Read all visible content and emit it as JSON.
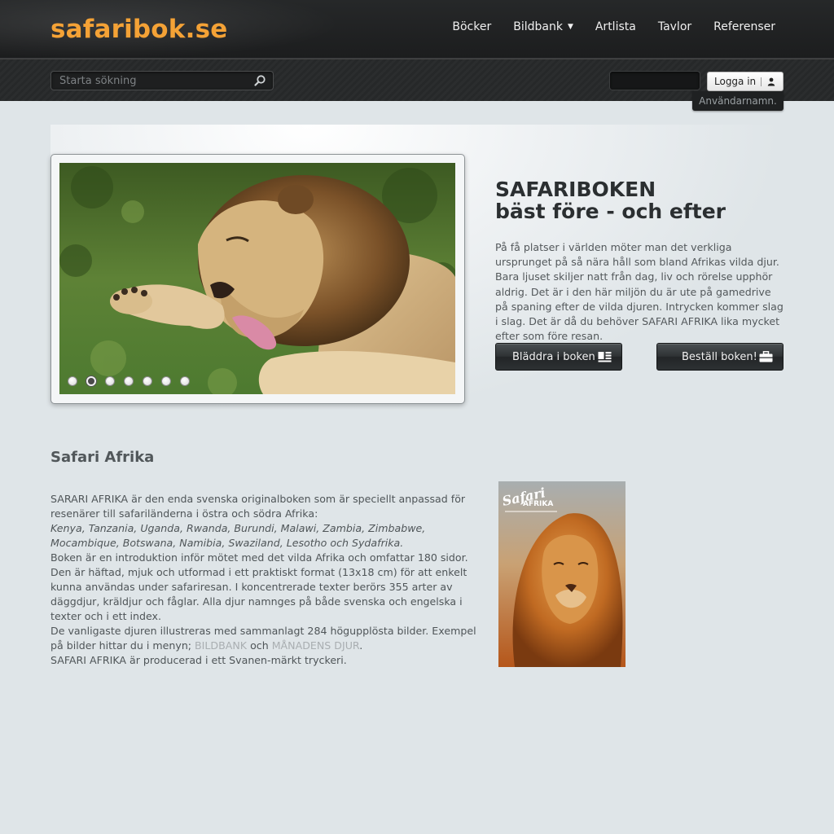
{
  "header": {
    "logo": "safaribok.se",
    "nav": [
      {
        "label": "Böcker"
      },
      {
        "label": "Bildbank",
        "dropdown": true,
        "caret": "▼"
      },
      {
        "label": "Artlista"
      },
      {
        "label": "Tavlor"
      },
      {
        "label": "Referenser"
      }
    ]
  },
  "subbar": {
    "search_placeholder": "Starta sökning",
    "login_label": "Logga in",
    "tooltip": "Användarnamn."
  },
  "hero": {
    "slider": {
      "dot_count": 7,
      "active_dot": 2
    },
    "title_line1": "SAFARIBOKEN",
    "title_line2": "bäst före - och efter",
    "text": "På få platser i världen möter man det verkliga ursprunget på så nära håll som bland Afrikas vilda djur. Bara ljuset skiljer natt från dag, liv och rörelse upphör aldrig. Det är i den här miljön du är ute på gamedrive på spaning efter de vilda djuren. Intrycken kommer slag i slag. Det är då du behöver SAFARI AFRIKA lika mycket efter som före resan.",
    "browse_button": "Bläddra i boken",
    "order_button": "Beställ boken!"
  },
  "content": {
    "title": "Safari Afrika",
    "p1": "SARARI AFRIKA är den enda svenska originalboken som är speciellt anpassad för resenärer till safariländerna i östra och södra Afrika:",
    "p1_countries": "Kenya, Tanzania, Uganda, Rwanda, Burundi, Malawi, Zambia, Zimbabwe, Mocambique, Botswana, Namibia, Swaziland, Lesotho och Sydafrika.",
    "p2": "Boken är en introduktion inför mötet med det vilda Afrika och omfattar 180 sidor.",
    "p3": "Den är häftad, mjuk och utformad i ett praktiskt format (13x18 cm) för att enkelt kunna användas under safariresan. I koncentrerade texter berörs 355 arter av däggdjur, kräldjur och fåglar. Alla djur namnges på både svenska och engelska i texter och i ett index.",
    "p4_start": "De vanligaste djuren illustreras med sammanlagt 284 högupplösta bilder. Exempel på bilder hittar du i menyn; ",
    "link_bildbank": "BILDBANK",
    "p4_and": " och ",
    "link_manadens": "MÅNADENS DJUR",
    "p4_end": ".",
    "p5": "SAFARI AFRIKA är producerad i ett Svanen-märkt tryckeri.",
    "cover": {
      "title_script": "Safari",
      "title": "AFRIKA"
    }
  },
  "colors": {
    "logo": "#f4a236",
    "page_bg": "#dfe5e8",
    "header_bg": "#1e1f20"
  },
  "icons": [
    "search-icon",
    "user-icon",
    "book-icon",
    "briefcase-icon"
  ]
}
